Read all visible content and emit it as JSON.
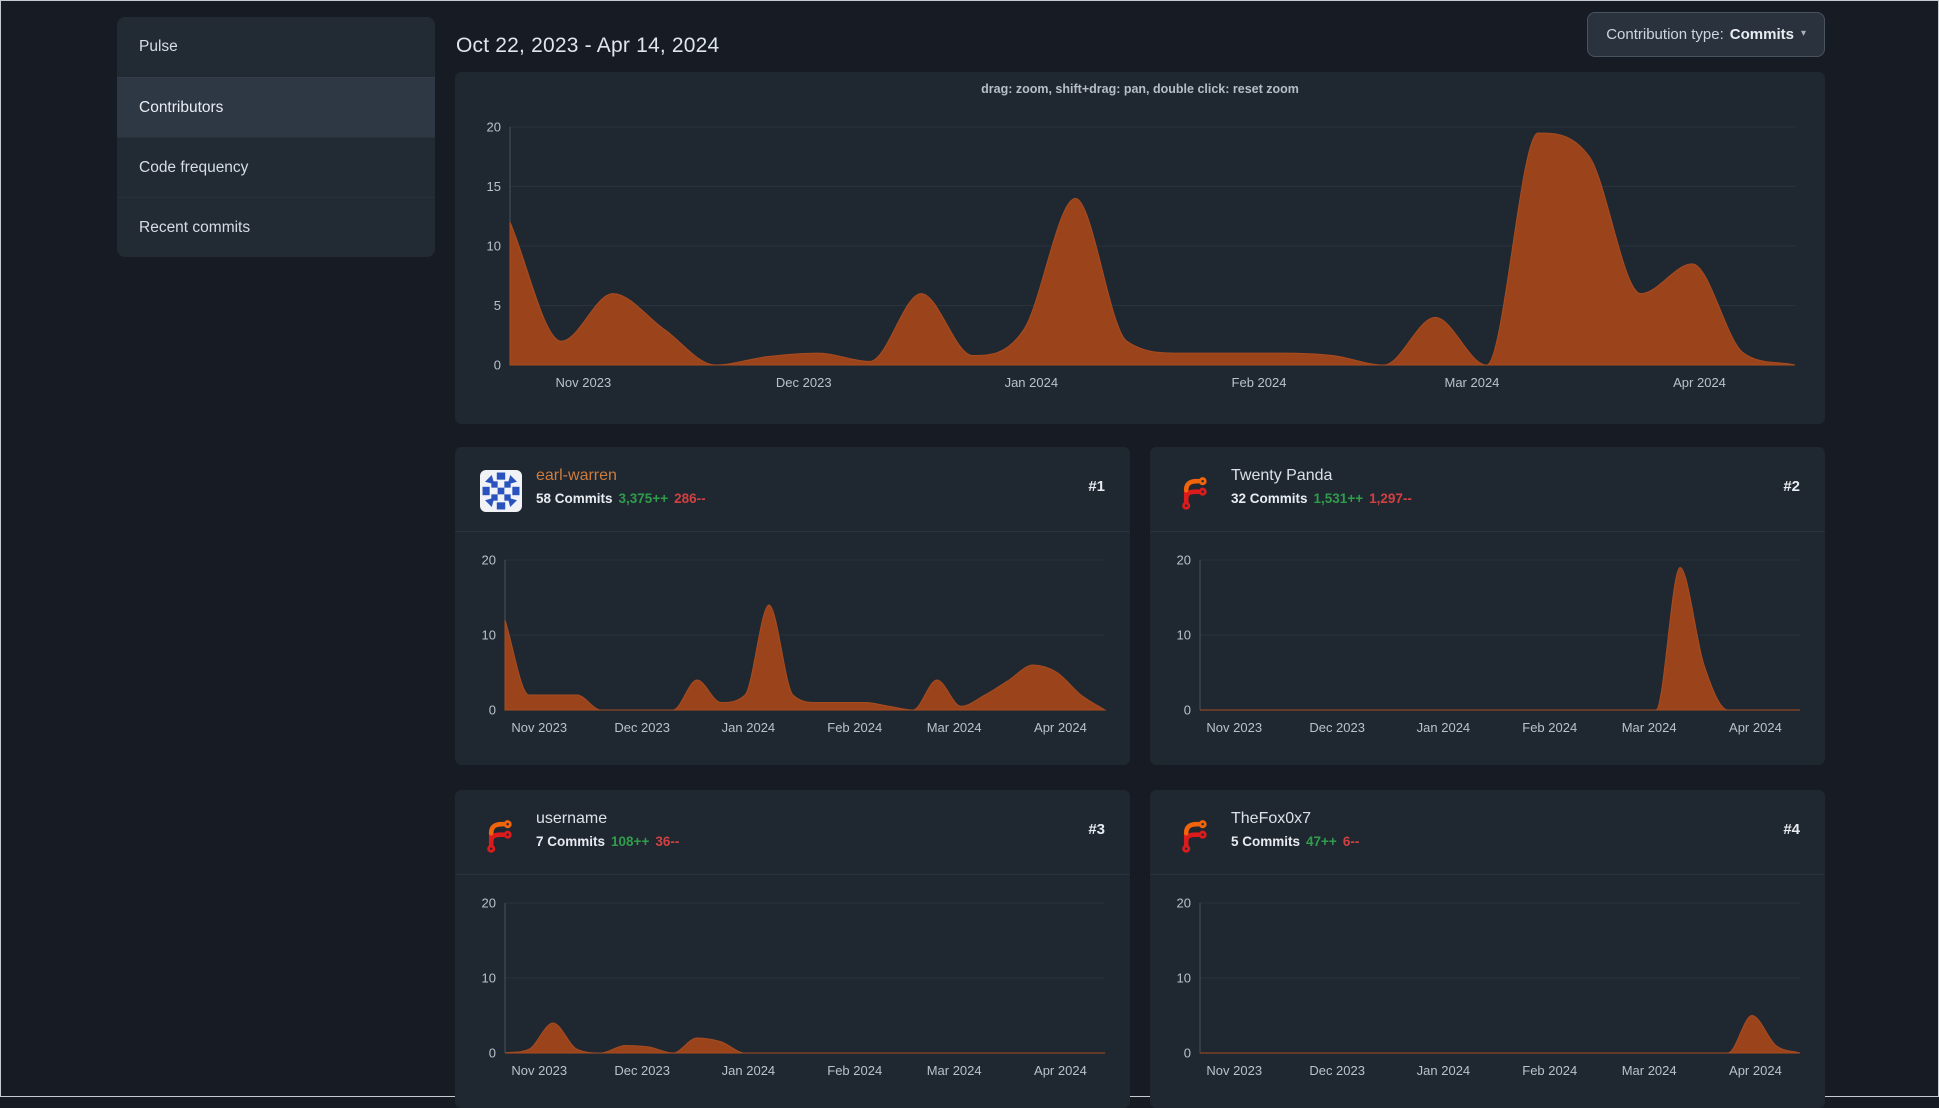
{
  "sidebar": {
    "items": [
      {
        "label": "Pulse",
        "active": false
      },
      {
        "label": "Contributors",
        "active": true
      },
      {
        "label": "Code frequency",
        "active": false
      },
      {
        "label": "Recent commits",
        "active": false
      }
    ]
  },
  "header": {
    "date_range": "Oct 22, 2023 - Apr 14, 2024",
    "type_label": "Contribution type:",
    "type_value": "Commits",
    "caret": "▾"
  },
  "main_chart": {
    "hint": "drag: zoom, shift+drag: pan, double click: reset zoom"
  },
  "cards": [
    {
      "rank": "#1",
      "name": "earl-warren",
      "commits": "58 Commits",
      "additions": "3,375++",
      "deletions": "286--",
      "avatar": "identicon-blue"
    },
    {
      "rank": "#2",
      "name": "Twenty Panda",
      "commits": "32 Commits",
      "additions": "1,531++",
      "deletions": "1,297--",
      "avatar": "forgejo-logo"
    },
    {
      "rank": "#3",
      "name": "username",
      "commits": "7 Commits",
      "additions": "108++",
      "deletions": "36--",
      "avatar": "forgejo-logo"
    },
    {
      "rank": "#4",
      "name": "TheFox0x7",
      "commits": "5 Commits",
      "additions": "47++",
      "deletions": "6--",
      "avatar": "forgejo-logo"
    }
  ],
  "colors": {
    "page_bg": "#161b24",
    "card_bg": "#1f2731",
    "menu_bg": "#222a34",
    "menu_active_bg": "#2e3744",
    "link_orange": "#cd7c3e",
    "additions_green": "#2f9d4b",
    "deletions_red": "#d14141",
    "chart_fill": "#9b441c",
    "chart_line": "#a84c1f",
    "chart_grid": "#2a323d",
    "chart_axis": "#49525e",
    "chart_tick_text": "#b9c1cb"
  },
  "chart_data": {
    "type": "area",
    "unit": "commits per week",
    "x_range": [
      "Oct 22, 2023",
      "Apr 14, 2024"
    ],
    "x_tick_labels": [
      "Nov 2023",
      "Dec 2023",
      "Jan 2024",
      "Feb 2024",
      "Mar 2024",
      "Apr 2024"
    ],
    "x_tick_fractions": [
      0.0571,
      0.2286,
      0.4057,
      0.5829,
      0.7486,
      0.9257
    ],
    "ylim": [
      0,
      20
    ],
    "grid": true,
    "legend": "none",
    "charts": [
      {
        "id": "main",
        "title": "repository commit activity",
        "y_ticks": [
          0,
          5,
          10,
          15,
          20
        ],
        "values": [
          12,
          2,
          6,
          3,
          0,
          0.7,
          1,
          0.3,
          6,
          0.8,
          3,
          14,
          2,
          1,
          1,
          1,
          0.8,
          0,
          4,
          0,
          19.5,
          17.5,
          6,
          8.5,
          1,
          0
        ]
      },
      {
        "id": "card-0",
        "title": "earl-warren commits",
        "y_ticks": [
          0,
          10,
          20
        ],
        "values": [
          12,
          2,
          2,
          2,
          0,
          0,
          0,
          0,
          4,
          1,
          2,
          14,
          2,
          1,
          1,
          1,
          0.5,
          0,
          4,
          0.5,
          2,
          4,
          6,
          5,
          2,
          0
        ]
      },
      {
        "id": "card-1",
        "title": "Twenty Panda commits",
        "y_ticks": [
          0,
          10,
          20
        ],
        "values": [
          0,
          0,
          0,
          0,
          0,
          0,
          0,
          0,
          0,
          0,
          0,
          0,
          0,
          0,
          0,
          0,
          0,
          0,
          0,
          0,
          19,
          6,
          0,
          0,
          0,
          0
        ]
      },
      {
        "id": "card-2",
        "title": "username commits",
        "y_ticks": [
          0,
          10,
          20
        ],
        "values": [
          0,
          0.5,
          4,
          0.5,
          0,
          1,
          0.8,
          0,
          2,
          1.5,
          0,
          0,
          0,
          0,
          0,
          0,
          0,
          0,
          0,
          0,
          0,
          0,
          0,
          0,
          0,
          0
        ]
      },
      {
        "id": "card-3",
        "title": "TheFox0x7 commits",
        "y_ticks": [
          0,
          10,
          20
        ],
        "values": [
          0,
          0,
          0,
          0,
          0,
          0,
          0,
          0,
          0,
          0,
          0,
          0,
          0,
          0,
          0,
          0,
          0,
          0,
          0,
          0,
          0,
          0,
          0,
          5,
          1,
          0
        ]
      }
    ]
  }
}
